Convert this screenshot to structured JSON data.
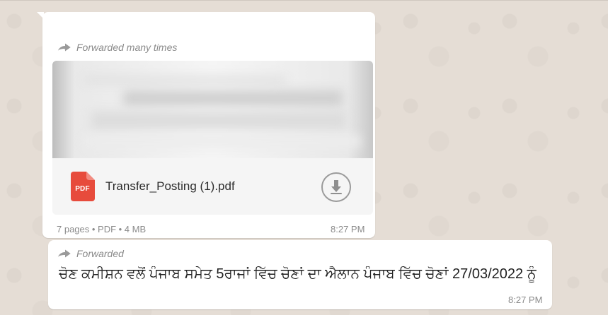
{
  "file_message": {
    "forwarded_label": "Forwarded many times",
    "file_name": "Transfer_Posting (1).pdf",
    "file_type_badge": "PDF",
    "meta": "7 pages • PDF • 4 MB",
    "time": "8:27 PM"
  },
  "text_message": {
    "forwarded_label": "Forwarded",
    "text": "ਚੋਣ ਕਮੀਸ਼ਨ ਵਲੋਂ ਪੰਜਾਬ ਸਮੇਤ 5ਰਾਜਾਂ ਵਿੱਚ ਚੋਣਾਂ ਦਾ ਐਲਾਨ ਪੰਜਾਬ ਵਿੱਚ ਚੋਣਾਂ 27/03/2022 ਨੂੰ",
    "time": "8:27 PM"
  },
  "icons": {
    "forward": "forward-arrow-icon",
    "pdf": "pdf-file-icon",
    "download": "download-arrow-icon"
  },
  "colors": {
    "chat_background": "#e5ddd5",
    "bubble_background": "#ffffff",
    "pdf_red": "#e74b3c"
  }
}
